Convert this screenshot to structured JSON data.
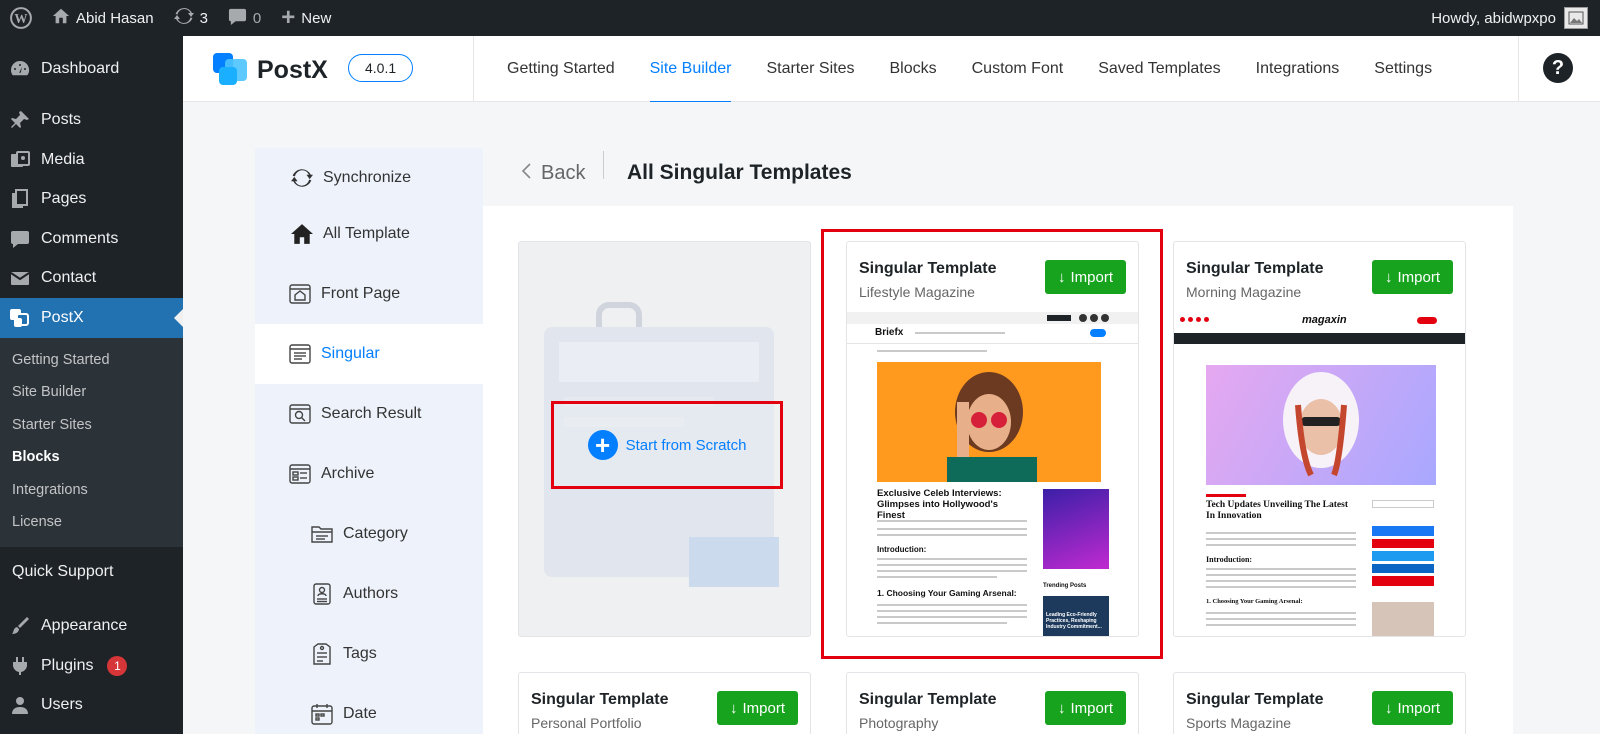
{
  "adminbar": {
    "site_name": "Abid Hasan",
    "updates_count": "3",
    "comments_count": "0",
    "new_label": "New",
    "howdy": "Howdy, abidwpxpo"
  },
  "menu": {
    "dashboard": "Dashboard",
    "posts": "Posts",
    "media": "Media",
    "pages": "Pages",
    "comments": "Comments",
    "contact": "Contact",
    "postx": "PostX",
    "submenu": [
      "Getting Started",
      "Site Builder",
      "Starter Sites",
      "Blocks",
      "Integrations",
      "License"
    ],
    "quick_support": "Quick Support",
    "appearance": "Appearance",
    "plugins": "Plugins",
    "plugins_badge": "1",
    "users": "Users"
  },
  "header": {
    "logo": "PostX",
    "version": "4.0.1",
    "tabs": [
      "Getting Started",
      "Site Builder",
      "Starter Sites",
      "Blocks",
      "Custom Font",
      "Saved Templates",
      "Integrations",
      "Settings"
    ],
    "active_tab": "Site Builder",
    "help": "?"
  },
  "sidebar": {
    "items": [
      "Synchronize",
      "All Template",
      "Front Page",
      "Singular",
      "Search Result",
      "Archive",
      "Category",
      "Authors",
      "Tags",
      "Date"
    ],
    "active": "Singular"
  },
  "main": {
    "back": "Back",
    "title": "All Singular Templates",
    "scratch_label": "Start from Scratch",
    "import_label": "Import",
    "cards": [
      {
        "title": "Singular Template",
        "subtitle": "Lifestyle Magazine"
      },
      {
        "title": "Singular Template",
        "subtitle": "Morning Magazine"
      },
      {
        "title": "Singular Template",
        "subtitle": "Personal Portfolio"
      },
      {
        "title": "Singular Template",
        "subtitle": "Photography"
      },
      {
        "title": "Singular Template",
        "subtitle": "Sports Magazine"
      }
    ],
    "preview1": {
      "brand": "Briefx",
      "headline": "Exclusive Celeb Interviews: Glimpses into Hollywood's Finest",
      "intro": "Introduction:",
      "section": "1. Choosing Your Gaming Arsenal:",
      "trending": "Trending Posts",
      "side_story": "Leading Eco-Friendly Practices, Reshaping Industry Commitment..."
    },
    "preview2": {
      "brand": "magaxin",
      "headline": "Tech Updates Unveiling The Latest In Innovation",
      "intro": "Introduction:",
      "section": "1. Choosing Your Gaming Arsenal:"
    }
  },
  "colors": {
    "wp_dark": "#1d2327",
    "wp_blue": "#2271b1",
    "postx_blue": "#037fff",
    "import_green": "#18a31e",
    "highlight_red": "#e3000f"
  }
}
